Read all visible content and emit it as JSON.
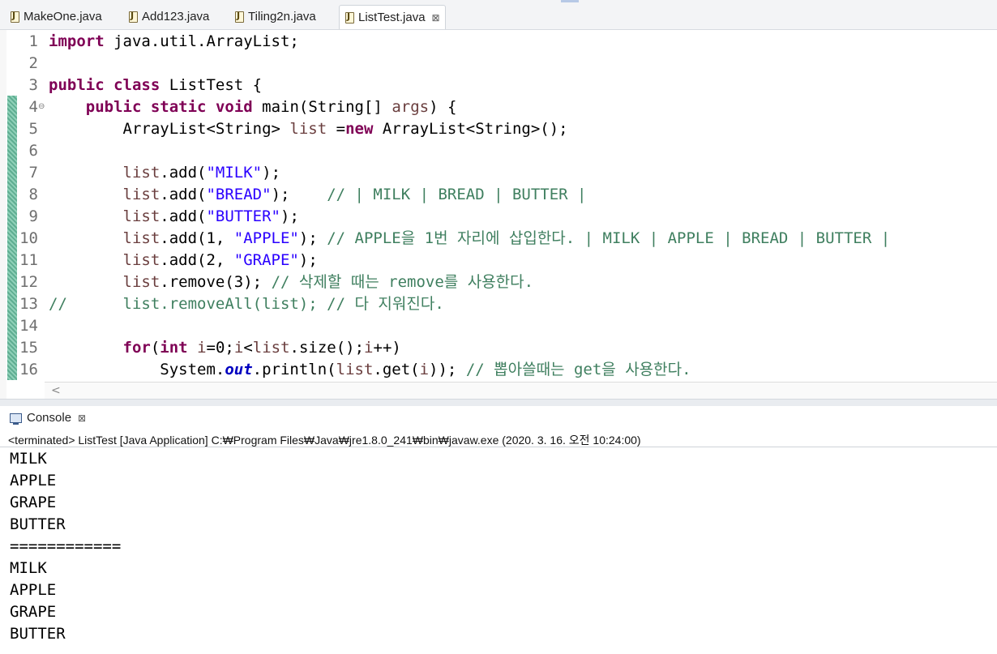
{
  "tabs": [
    {
      "label": "MakeOne.java",
      "active": false
    },
    {
      "label": "Add123.java",
      "active": false
    },
    {
      "label": "Tiling2n.java",
      "active": false
    },
    {
      "label": "ListTest.java",
      "active": true
    }
  ],
  "editor": {
    "lines": [
      {
        "num": "1",
        "tokens": [
          {
            "t": "import",
            "c": "kw"
          },
          {
            "t": " java.util.ArrayList;"
          }
        ]
      },
      {
        "num": "2",
        "tokens": []
      },
      {
        "num": "3",
        "tokens": [
          {
            "t": "public",
            "c": "kw"
          },
          {
            "t": " "
          },
          {
            "t": "class",
            "c": "kw"
          },
          {
            "t": " ListTest {"
          }
        ]
      },
      {
        "num": "4",
        "tokens": [
          {
            "t": "    "
          },
          {
            "t": "public",
            "c": "kw"
          },
          {
            "t": " "
          },
          {
            "t": "static",
            "c": "kw"
          },
          {
            "t": " "
          },
          {
            "t": "void",
            "c": "kw"
          },
          {
            "t": " main(String[] "
          },
          {
            "t": "args",
            "c": "var"
          },
          {
            "t": ") {"
          }
        ]
      },
      {
        "num": "5",
        "tokens": [
          {
            "t": "        ArrayList<String> "
          },
          {
            "t": "list",
            "c": "var"
          },
          {
            "t": " ="
          },
          {
            "t": "new",
            "c": "kw"
          },
          {
            "t": " ArrayList<String>();"
          }
        ]
      },
      {
        "num": "6",
        "tokens": []
      },
      {
        "num": "7",
        "tokens": [
          {
            "t": "        "
          },
          {
            "t": "list",
            "c": "var"
          },
          {
            "t": ".add("
          },
          {
            "t": "\"MILK\"",
            "c": "str"
          },
          {
            "t": ");"
          }
        ]
      },
      {
        "num": "8",
        "tokens": [
          {
            "t": "        "
          },
          {
            "t": "list",
            "c": "var"
          },
          {
            "t": ".add("
          },
          {
            "t": "\"BREAD\"",
            "c": "str"
          },
          {
            "t": ");    "
          },
          {
            "t": "// | MILK | BREAD | BUTTER |",
            "c": "cm"
          }
        ]
      },
      {
        "num": "9",
        "tokens": [
          {
            "t": "        "
          },
          {
            "t": "list",
            "c": "var"
          },
          {
            "t": ".add("
          },
          {
            "t": "\"BUTTER\"",
            "c": "str"
          },
          {
            "t": ");"
          }
        ]
      },
      {
        "num": "10",
        "tokens": [
          {
            "t": "        "
          },
          {
            "t": "list",
            "c": "var"
          },
          {
            "t": ".add(1, "
          },
          {
            "t": "\"APPLE\"",
            "c": "str"
          },
          {
            "t": "); "
          },
          {
            "t": "// APPLE을 1번 자리에 삽입한다. | MILK | APPLE | BREAD | BUTTER |",
            "c": "cm"
          }
        ]
      },
      {
        "num": "11",
        "tokens": [
          {
            "t": "        "
          },
          {
            "t": "list",
            "c": "var"
          },
          {
            "t": ".add(2, "
          },
          {
            "t": "\"GRAPE\"",
            "c": "str"
          },
          {
            "t": ");"
          }
        ]
      },
      {
        "num": "12",
        "tokens": [
          {
            "t": "        "
          },
          {
            "t": "list",
            "c": "var"
          },
          {
            "t": ".remove(3); "
          },
          {
            "t": "// 삭제할 때는 remove를 사용한다.",
            "c": "cm"
          }
        ]
      },
      {
        "num": "13",
        "tokens": [
          {
            "t": "//      list.removeAll(list); // 다 지워진다.",
            "c": "cm"
          }
        ]
      },
      {
        "num": "14",
        "tokens": []
      },
      {
        "num": "15",
        "tokens": [
          {
            "t": "        "
          },
          {
            "t": "for",
            "c": "kw"
          },
          {
            "t": "("
          },
          {
            "t": "int",
            "c": "kw"
          },
          {
            "t": " "
          },
          {
            "t": "i",
            "c": "var"
          },
          {
            "t": "=0;"
          },
          {
            "t": "i",
            "c": "var"
          },
          {
            "t": "<"
          },
          {
            "t": "list",
            "c": "var"
          },
          {
            "t": ".size();"
          },
          {
            "t": "i",
            "c": "var"
          },
          {
            "t": "++)"
          }
        ]
      },
      {
        "num": "16",
        "tokens": [
          {
            "t": "            System."
          },
          {
            "t": "out",
            "c": "fld"
          },
          {
            "t": ".println("
          },
          {
            "t": "list",
            "c": "var"
          },
          {
            "t": ".get("
          },
          {
            "t": "i",
            "c": "var"
          },
          {
            "t": ")); "
          },
          {
            "t": "// 뽑아쓸때는 get을 사용한다.",
            "c": "cm"
          }
        ]
      }
    ]
  },
  "console": {
    "tab_label": "Console",
    "status": "<terminated> ListTest [Java Application] C:₩Program Files₩Java₩jre1.8.0_241₩bin₩javaw.exe (2020. 3. 16. 오전 10:24:00)",
    "output": [
      "MILK",
      "APPLE",
      "GRAPE",
      "BUTTER",
      "============",
      "MILK",
      "APPLE",
      "GRAPE",
      "BUTTER"
    ]
  }
}
